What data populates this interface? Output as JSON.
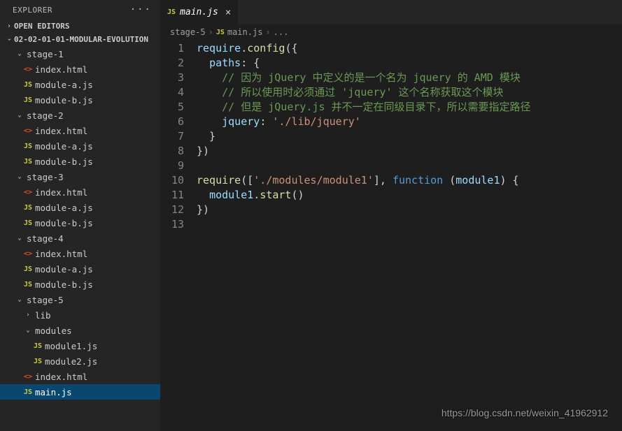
{
  "sidebar": {
    "title": "EXPLORER",
    "sections": {
      "openEditors": "OPEN EDITORS",
      "project": "02-02-01-01-MODULAR-EVOLUTION"
    },
    "tree": [
      {
        "t": "f",
        "d": 1,
        "n": "stage-1",
        "open": true
      },
      {
        "t": "html",
        "d": 2,
        "n": "index.html"
      },
      {
        "t": "js",
        "d": 2,
        "n": "module-a.js"
      },
      {
        "t": "js",
        "d": 2,
        "n": "module-b.js"
      },
      {
        "t": "f",
        "d": 1,
        "n": "stage-2",
        "open": true
      },
      {
        "t": "html",
        "d": 2,
        "n": "index.html"
      },
      {
        "t": "js",
        "d": 2,
        "n": "module-a.js"
      },
      {
        "t": "js",
        "d": 2,
        "n": "module-b.js"
      },
      {
        "t": "f",
        "d": 1,
        "n": "stage-3",
        "open": true
      },
      {
        "t": "html",
        "d": 2,
        "n": "index.html"
      },
      {
        "t": "js",
        "d": 2,
        "n": "module-a.js"
      },
      {
        "t": "js",
        "d": 2,
        "n": "module-b.js"
      },
      {
        "t": "f",
        "d": 1,
        "n": "stage-4",
        "open": true
      },
      {
        "t": "html",
        "d": 2,
        "n": "index.html"
      },
      {
        "t": "js",
        "d": 2,
        "n": "module-a.js"
      },
      {
        "t": "js",
        "d": 2,
        "n": "module-b.js"
      },
      {
        "t": "f",
        "d": 1,
        "n": "stage-5",
        "open": true
      },
      {
        "t": "f",
        "d": 2,
        "n": "lib",
        "open": false
      },
      {
        "t": "f",
        "d": 2,
        "n": "modules",
        "open": true
      },
      {
        "t": "js",
        "d": 3,
        "n": "module1.js"
      },
      {
        "t": "js",
        "d": 3,
        "n": "module2.js"
      },
      {
        "t": "html",
        "d": 2,
        "n": "index.html"
      },
      {
        "t": "js",
        "d": 2,
        "n": "main.js",
        "sel": true
      }
    ]
  },
  "tab": {
    "file": "main.js"
  },
  "crumbs": {
    "a": "stage-5",
    "b": "main.js",
    "c": "..."
  },
  "code": {
    "lines": [
      {
        "n": 1,
        "html": "<span class='id'>require</span>.<span class='fn'>config</span>({"
      },
      {
        "n": 2,
        "html": "  <span class='id'>paths</span>: {"
      },
      {
        "n": 3,
        "html": "    <span class='cm'>// 因为 jQuery 中定义的是一个名为 jquery 的 AMD 模块</span>"
      },
      {
        "n": 4,
        "html": "    <span class='cm'>// 所以使用时必须通过 'jquery' 这个名称获取这个模块</span>"
      },
      {
        "n": 5,
        "html": "    <span class='cm'>// 但是 jQuery.js 并不一定在同级目录下，所以需要指定路径</span>"
      },
      {
        "n": 6,
        "html": "    <span class='id'>jquery</span>: <span class='str'>'./lib/jquery'</span>"
      },
      {
        "n": 7,
        "html": "  }"
      },
      {
        "n": 8,
        "html": "})"
      },
      {
        "n": 9,
        "html": ""
      },
      {
        "n": 10,
        "html": "<span class='fn'>require</span>([<span class='str'>'./modules/module1'</span>], <span class='kw'>function</span> (<span class='id'>module1</span>) {"
      },
      {
        "n": 11,
        "html": "  <span class='id'>module1</span>.<span class='fn'>start</span>()"
      },
      {
        "n": 12,
        "html": "})"
      },
      {
        "n": 13,
        "html": ""
      }
    ]
  },
  "watermark": "https://blog.csdn.net/weixin_41962912"
}
